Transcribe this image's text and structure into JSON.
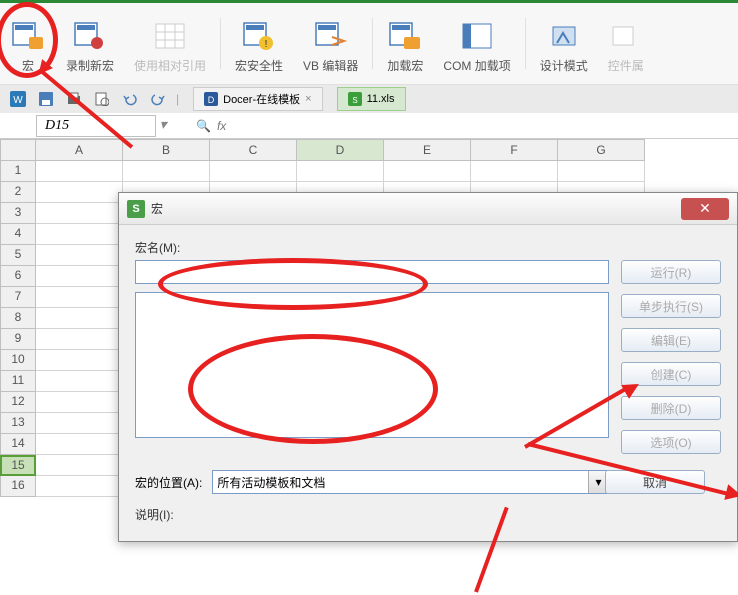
{
  "ribbon": {
    "items": [
      {
        "label": "宏",
        "disabled": false
      },
      {
        "label": "录制新宏",
        "disabled": false
      },
      {
        "label": "使用相对引用",
        "disabled": true
      },
      {
        "label": "宏安全性",
        "disabled": false
      },
      {
        "label": "VB 编辑器",
        "disabled": false
      },
      {
        "label": "加载宏",
        "disabled": false
      },
      {
        "label": "COM 加载项",
        "disabled": false
      },
      {
        "label": "设计模式",
        "disabled": false
      },
      {
        "label": "控件属",
        "disabled": true
      }
    ]
  },
  "tabs": {
    "docer": "Docer-在线模板",
    "file": "11.xls"
  },
  "namebox": "D15",
  "fx": "fx",
  "columns": [
    "A",
    "B",
    "C",
    "D",
    "E",
    "F",
    "G"
  ],
  "selected_col": "D",
  "rows": [
    "1",
    "2",
    "3",
    "4",
    "5",
    "6",
    "7",
    "8",
    "9",
    "10",
    "11",
    "12",
    "13",
    "14",
    "15",
    "16"
  ],
  "selected_row": "15",
  "dialog": {
    "title": "宏",
    "macro_name_label": "宏名(M):",
    "macro_location_label": "宏的位置(A):",
    "macro_location_value": "所有活动模板和文档",
    "desc_label": "说明(I):",
    "buttons": {
      "run": "运行(R)",
      "step": "单步执行(S)",
      "edit": "编辑(E)",
      "create": "创建(C)",
      "delete": "删除(D)",
      "options": "选项(O)",
      "cancel": "取消"
    }
  }
}
